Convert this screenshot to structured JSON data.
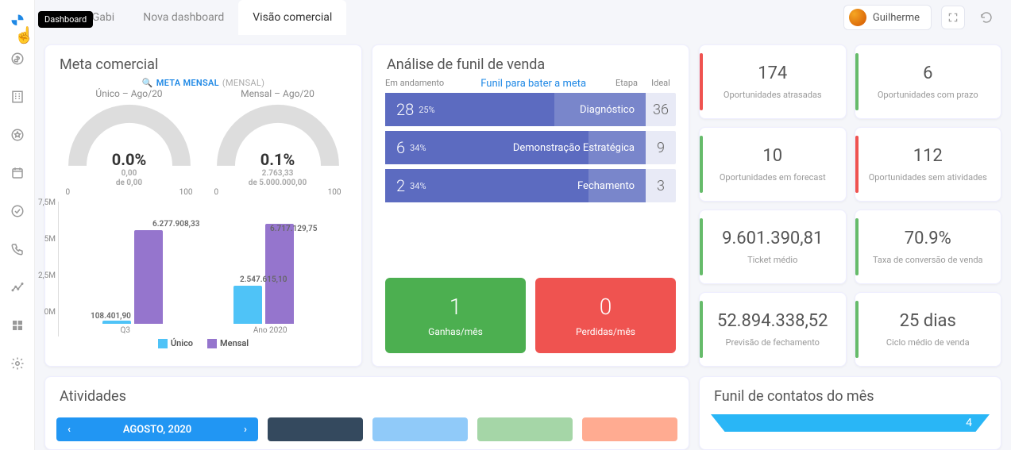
{
  "tooltip": "Dashboard",
  "tabs": [
    {
      "label": "Dash Gabi",
      "starred": true
    },
    {
      "label": "Nova dashboard",
      "starred": false
    },
    {
      "label": "Visão comercial",
      "starred": false,
      "active": true
    }
  ],
  "user": {
    "name": "Guilherme"
  },
  "meta": {
    "title": "Meta comercial",
    "subtitle": "META MENSAL",
    "subtitle_suffix": "(MENSAL)",
    "gauges": [
      {
        "title": "Único – Ago/20",
        "value": "0.0%",
        "line1": "0,00",
        "line2": "de 0,00",
        "min": "0",
        "max": "100"
      },
      {
        "title": "Mensal – Ago/20",
        "value": "0.1%",
        "line1": "2.763,33",
        "line2": "de 5.000.000,00",
        "min": "0",
        "max": "100"
      }
    ]
  },
  "chart_data": {
    "type": "bar",
    "categories": [
      "Q3",
      "Ano 2020"
    ],
    "series": [
      {
        "name": "Único",
        "values": [
          108401.9,
          2547615.1
        ]
      },
      {
        "name": "Mensal",
        "values": [
          6277908.33,
          6717129.75
        ]
      }
    ],
    "ylabel": "",
    "ylim": [
      0,
      7500000
    ],
    "ticks": [
      "7,5M",
      "5M",
      "2,5M",
      "0M"
    ],
    "labels": {
      "q3_unico": "108.401,90",
      "q3_mensal": "6.277.908,33",
      "ano_unico": "2.547.615,10",
      "ano_mensal": "6.717.129,75"
    }
  },
  "funil": {
    "title": "Análise de funil de venda",
    "header": {
      "left": "Em andamento",
      "center": "Funil para bater a meta",
      "stage": "Etapa",
      "ideal": "Ideal"
    },
    "rows": [
      {
        "count": "28",
        "pct": "25%",
        "stage": "Diagnóstico",
        "ideal": "36",
        "fill": 65
      },
      {
        "count": "6",
        "pct": "34%",
        "stage": "Demonstração Estratégica",
        "ideal": "9",
        "fill": 78
      },
      {
        "count": "2",
        "pct": "34%",
        "stage": "Fechamento",
        "ideal": "3",
        "fill": 78
      }
    ],
    "ganhas": {
      "num": "1",
      "label": "Ganhas/mês"
    },
    "perdidas": {
      "num": "0",
      "label": "Perdidas/mês"
    }
  },
  "kpis": [
    {
      "value": "174",
      "label": "Oportunidades atrasadas",
      "accent": "red"
    },
    {
      "value": "6",
      "label": "Oportunidades com prazo",
      "accent": "green"
    },
    {
      "value": "10",
      "label": "Oportunidades em forecast",
      "accent": "green"
    },
    {
      "value": "112",
      "label": "Oportunidades sem atividades",
      "accent": "red"
    },
    {
      "value": "9.601.390,81",
      "label": "Ticket médio",
      "accent": "green"
    },
    {
      "value": "70.9%",
      "label": "Taxa de conversão de venda",
      "accent": "green"
    },
    {
      "value": "52.894.338,52",
      "label": "Previsão de fechamento",
      "accent": "green"
    },
    {
      "value": "25 dias",
      "label": "Ciclo médio de venda",
      "accent": "green"
    }
  ],
  "atividades": {
    "title": "Atividades",
    "month": "AGOSTO, 2020",
    "colors": [
      "#34495e",
      "#90caf9",
      "#a5d6a7",
      "#ffab91"
    ]
  },
  "contatos": {
    "title": "Funil de contatos do mês",
    "top_value": "4"
  }
}
